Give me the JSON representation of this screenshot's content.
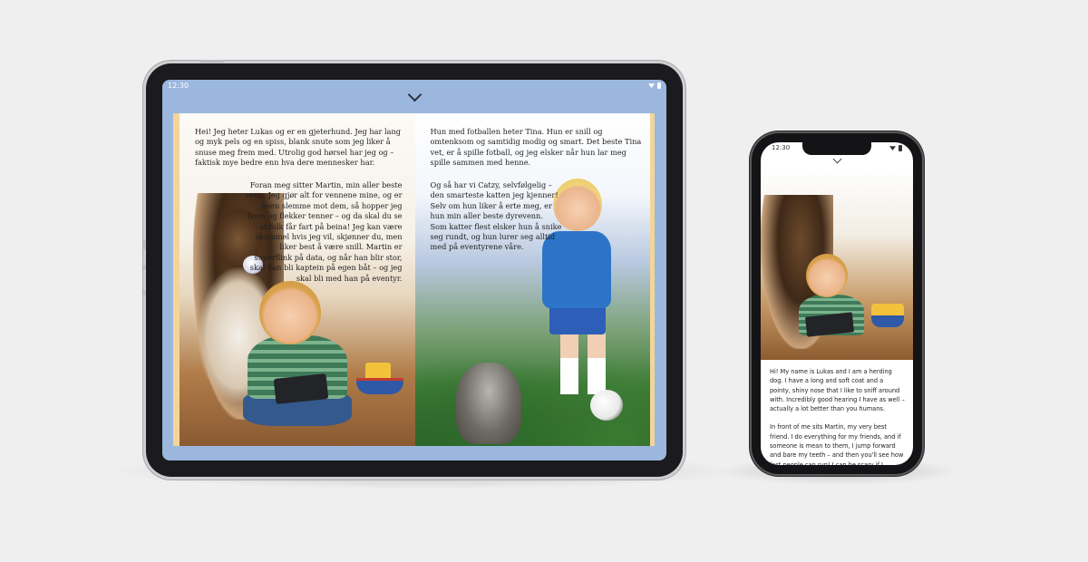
{
  "tablet": {
    "status_time": "12:30",
    "left_page": {
      "paragraph1": "Hei! Jeg heter Lukas og er en gjeterhund. Jeg har lang og myk pels og en spiss, blank snute som jeg liker å snuse meg frem med. Utrolig god hørsel har jeg og – faktisk mye bedre enn hva dere mennesker har.",
      "paragraph2": "Foran meg sitter Martin, min aller beste venn. Jeg gjør alt for vennene mine, og er noen slemme mot dem, så hopper jeg frem og flekker tenner – og da skal du se at folk får fart på beina! Jeg kan være skummel hvis jeg vil, skjønner du, men liker best å være snill. Martin er superflink på data, og når han blir stor, skal han bli kaptein på egen båt – og jeg skal bli med han på eventyr."
    },
    "right_page": {
      "paragraph1": "Hun med fotballen heter Tina. Hun er snill og omtenksom og samtidig modig og smart. Det beste Tina vet, er å spille fotball, og jeg elsker når hun lar meg spille sammen med henne.",
      "paragraph2": "Og så har vi Catzy, selvfølgelig – den smarteste katten jeg kjenner! Selv om hun liker å erte meg, er hun min aller beste dyrevenn. Som katter flest elsker hun å snike seg rundt, og hun lurer seg alltid med på eventyrene våre."
    }
  },
  "phone": {
    "status_time": "12:30",
    "paragraph1": "Hi! My name is Lukas and I am a herding dog. I have a long and soft coat and a pointy, shiny nose that I like to sniff around with. Incredibly good hearing I have as well – actually a lot better than you humans.",
    "paragraph2": "In front of me sits Martin, my very best friend. I do everything for my friends, and if someone is mean to them, I jump forward and bare my teeth – and then you'll see how fast people can run! I can be scary if I"
  },
  "colors": {
    "tablet_screen_bg": "#9cb7de",
    "book_edge": "#f3d598"
  }
}
